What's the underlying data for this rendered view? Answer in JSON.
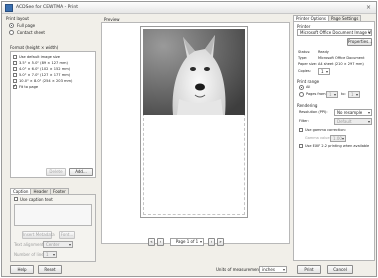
{
  "window": {
    "title": "ACDSee for CEWTMA - Print",
    "close_glyph": "×"
  },
  "layout": {
    "group_label": "Print layout",
    "full_page": "Full page",
    "contact_sheet": "Contact sheet",
    "selected": "full_page"
  },
  "format": {
    "label": "Format (height × width)",
    "items": [
      {
        "label": "Use default image size",
        "checked": false
      },
      {
        "label": "3.5\" × 5.0\" (89 × 127 mm)",
        "checked": false
      },
      {
        "label": "4.0\" × 6.0\" (102 × 152 mm)",
        "checked": false
      },
      {
        "label": "5.0\" × 7.0\" (127 × 177 mm)",
        "checked": false
      },
      {
        "label": "10.0\" × 8.0\" (254 × 203 mm)",
        "checked": false
      },
      {
        "label": "Fit to page",
        "checked": true
      }
    ],
    "delete_label": "Delete",
    "add_label": "Add..."
  },
  "caption": {
    "tabs": [
      "Caption",
      "Header",
      "Footer"
    ],
    "use_caption_text": "Use caption text",
    "insert_metadata": "Insert Metadata",
    "font": "Font...",
    "text_alignment": "Text alignment:",
    "alignment_value": "Center",
    "number_of_lines": "Number of lines:",
    "lines_value": "1"
  },
  "preview": {
    "label": "Preview",
    "page_indicator": "Page 1 of 1"
  },
  "right_panel": {
    "tabs": [
      "Printer Options",
      "Page Settings"
    ],
    "printer_section": "Printer",
    "printer_name": "Microsoft Office Document Image Writer",
    "properties": "Properties...",
    "status_key": "Status:",
    "status_val": "Ready",
    "type_key": "Type:",
    "type_val": "Microsoft Office Document",
    "paper_key": "Paper size:",
    "paper_val": "A4 sheet (210 × 297 mm)",
    "copies_key": "Copies:",
    "copies_val": "1",
    "print_range": "Print range",
    "all": "All",
    "pages_from": "Pages from:",
    "from_val": "1",
    "to": "to:",
    "to_val": "1",
    "rendering": "Rendering",
    "resolution_key": "Resolution (PPI):",
    "resolution_val": "No resample",
    "filter_key": "Filter:",
    "filter_val": "Default",
    "gamma": "Use gamma correction:",
    "gamma_val_key": "Gamma value:",
    "gamma_val": "1.00",
    "exif": "Use EXIF 2.2 printing when available"
  },
  "footer": {
    "help": "Help",
    "reset": "Reset",
    "units_label": "Units of measurement:",
    "units_value": "inches",
    "print": "Print",
    "cancel": "Cancel"
  },
  "colors": {
    "accent": "#3a6fb0",
    "window_bg": "#f1efe9"
  }
}
